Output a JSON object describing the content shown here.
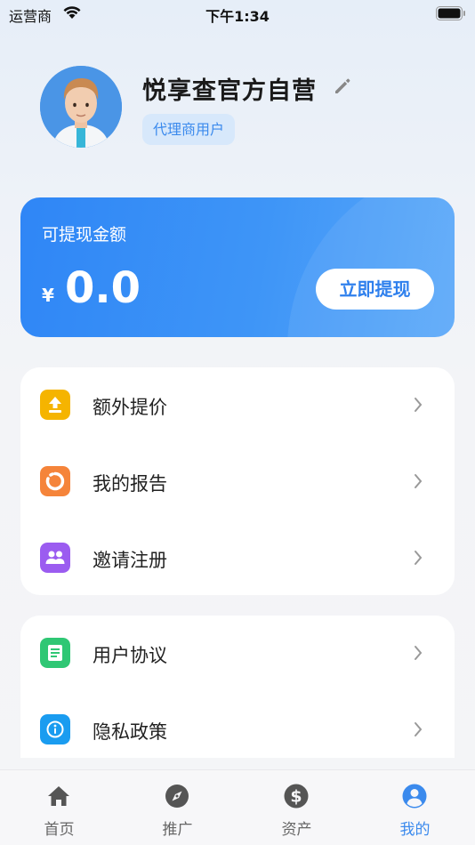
{
  "status_bar": {
    "carrier": "运营商",
    "time": "下午1:34"
  },
  "profile": {
    "name": "悦享查官方自营",
    "role": "代理商用户"
  },
  "balance": {
    "label": "可提现金额",
    "currency": "¥",
    "amount": "0.0",
    "withdraw_label": "立即提现"
  },
  "menu_group_1": [
    {
      "label": "额外提价",
      "icon": "upload-icon",
      "color": "#f5b400"
    },
    {
      "label": "我的报告",
      "icon": "report-icon",
      "color": "#f5843a"
    },
    {
      "label": "邀请注册",
      "icon": "group-icon",
      "color": "#9b5cf0"
    }
  ],
  "menu_group_2": [
    {
      "label": "用户协议",
      "icon": "document-icon",
      "color": "#2fc774"
    },
    {
      "label": "隐私政策",
      "icon": "info-icon",
      "color": "#1a9cf0"
    }
  ],
  "tabbar": [
    {
      "label": "首页",
      "icon": "home-icon"
    },
    {
      "label": "推广",
      "icon": "compass-icon"
    },
    {
      "label": "资产",
      "icon": "dollar-icon"
    },
    {
      "label": "我的",
      "icon": "user-icon",
      "active": true
    }
  ],
  "colors": {
    "accent": "#3b8aed",
    "card_gradient_start": "#2f86f6",
    "card_gradient_end": "#5aa8f9"
  }
}
